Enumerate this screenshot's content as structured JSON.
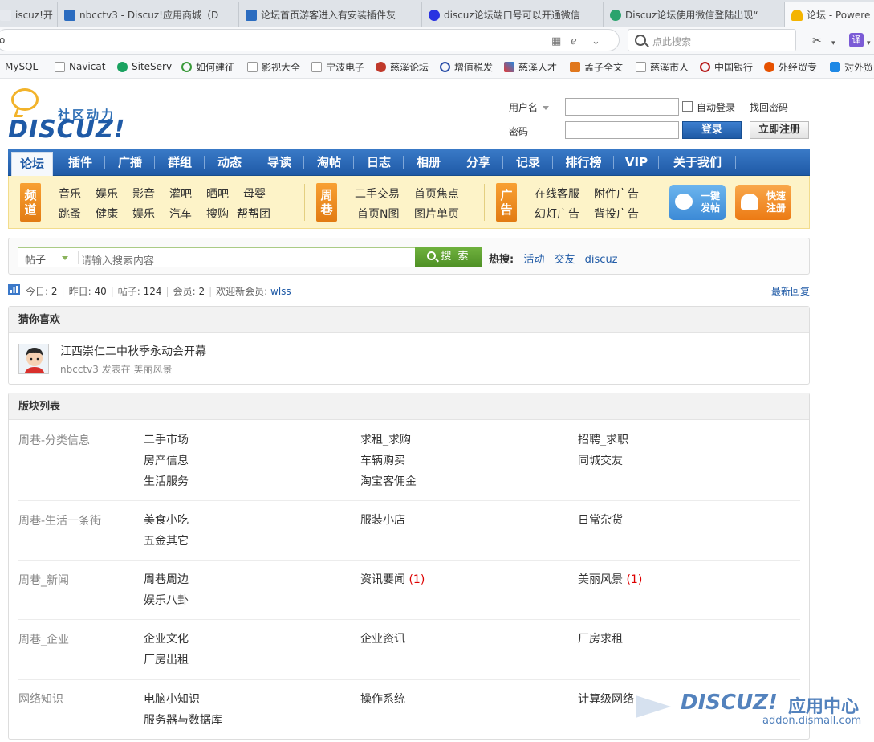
{
  "browser": {
    "tabs": [
      {
        "label": "iscuz!开",
        "color": "#2b6cc0"
      },
      {
        "label": "nbcctv3 - Discuz!应用商城（D",
        "color": "#2b6cc0"
      },
      {
        "label": "论坛首页游客进入有安装插件灰",
        "color": "#2b6cc0"
      },
      {
        "label": "discuz论坛端口号可以开通微信",
        "color": "#2932e1"
      },
      {
        "label": "Discuz论坛使用微信登陆出现“",
        "color": "#2aa36d"
      },
      {
        "label": "论坛 - Powere",
        "color": "#f4b400"
      }
    ],
    "url_hint": "o",
    "search_placeholder": "点此搜索",
    "translate_label": "译",
    "bookmarks": [
      {
        "label": "MySQL",
        "icon": "page-icon"
      },
      {
        "label": "Navicat",
        "icon": "page-icon"
      },
      {
        "label": "SiteServ",
        "icon": "siteserver-icon"
      },
      {
        "label": "如何建征",
        "icon": "check-icon"
      },
      {
        "label": "影视大全",
        "icon": "page-icon"
      },
      {
        "label": "宁波电子",
        "icon": "page-icon"
      },
      {
        "label": "慈溪论坛",
        "icon": "forum-icon"
      },
      {
        "label": "增值税发",
        "icon": "tax-icon"
      },
      {
        "label": "慈溪人才",
        "icon": "talent-icon"
      },
      {
        "label": "孟子全文",
        "icon": "house-icon"
      },
      {
        "label": "慈溪市人",
        "icon": "page-icon"
      },
      {
        "label": "中国银行",
        "icon": "bank-icon"
      },
      {
        "label": "外经贸专",
        "icon": "trade-icon"
      },
      {
        "label": "对外贸",
        "icon": "globe-icon"
      }
    ]
  },
  "header": {
    "slogan": "社区动力",
    "brand": "DISCUZ!",
    "login": {
      "username_label": "用户名",
      "password_label": "密码",
      "auto_login": "自动登录",
      "find_password": "找回密码",
      "login_button": "登录",
      "register_button": "立即注册"
    }
  },
  "nav": {
    "items": [
      "论坛",
      "插件",
      "广播",
      "群组",
      "动态",
      "导读",
      "淘帖",
      "日志",
      "相册",
      "分享",
      "记录",
      "排行榜",
      "VIP",
      "关于我们"
    ],
    "active": "论坛"
  },
  "quicknav": {
    "channel_tag": "频道",
    "channel_links": [
      [
        "音乐",
        "娱乐",
        "影音",
        "灌吧",
        "晒吧",
        "母婴"
      ],
      [
        "跳蚤",
        "健康",
        "娱乐",
        "汽车",
        "搜购",
        "帮帮团"
      ]
    ],
    "alley_tag": "周巷",
    "alley_links": [
      [
        "二手交易",
        "首页焦点"
      ],
      [
        "首页N图",
        "图片单页"
      ]
    ],
    "ad_tag": "广告",
    "ad_links": [
      [
        "在线客服",
        "附件广告"
      ],
      [
        "幻灯广告",
        "背投广告"
      ]
    ],
    "post_button": "一键发帖",
    "register_button": "快速注册"
  },
  "search": {
    "type": "帖子",
    "placeholder": "请输入搜索内容",
    "button": "搜 索",
    "hot_label": "热搜:",
    "hot_terms": [
      "活动",
      "交友",
      "discuz"
    ]
  },
  "stats": {
    "today_label": "今日:",
    "today": "2",
    "yesterday_label": "昨日:",
    "yesterday": "40",
    "posts_label": "帖子:",
    "posts": "124",
    "members_label": "会员:",
    "members": "2",
    "welcome_label": "欢迎新会员:",
    "new_member": "wlss",
    "latest_reply": "最新回复"
  },
  "recommend": {
    "title": "猜你喜欢",
    "item_title": "江西崇仁二中秋季永动会开幕",
    "item_author": "nbcctv3",
    "item_posted_in": "发表在",
    "item_forum": "美丽风景"
  },
  "forums": {
    "title": "版块列表",
    "groups": [
      {
        "name": "周巷-分类信息",
        "cols": [
          [
            "二手市场",
            "房产信息",
            "生活服务"
          ],
          [
            "求租_求购",
            "车辆购买",
            "淘宝客佣金"
          ],
          [
            "招聘_求职",
            "同城交友"
          ]
        ],
        "counts": [
          [],
          [],
          []
        ]
      },
      {
        "name": "周巷-生活一条街",
        "cols": [
          [
            "美食小吃",
            "五金其它"
          ],
          [
            "服装小店"
          ],
          [
            "日常杂货"
          ]
        ],
        "counts": [
          [],
          [],
          []
        ]
      },
      {
        "name": "周巷_新闻",
        "cols": [
          [
            "周巷周边",
            "娱乐八卦"
          ],
          [
            "资讯要闻"
          ],
          [
            "美丽风景"
          ]
        ],
        "counts": [
          [],
          [
            "(1)"
          ],
          [
            "(1)"
          ]
        ]
      },
      {
        "name": "周巷_企业",
        "cols": [
          [
            "企业文化",
            "厂房出租"
          ],
          [
            "企业资讯"
          ],
          [
            "厂房求租"
          ]
        ],
        "counts": [
          [],
          [],
          []
        ]
      },
      {
        "name": "网络知识",
        "cols": [
          [
            "电脑小知识",
            "服务器与数据库"
          ],
          [
            "操作系统"
          ],
          [
            "计算级网络"
          ]
        ],
        "counts": [
          [],
          [],
          []
        ]
      }
    ]
  },
  "watermark": {
    "brand": "DISCUZ!",
    "app": "应用中心",
    "url": "addon.dismall.com"
  }
}
